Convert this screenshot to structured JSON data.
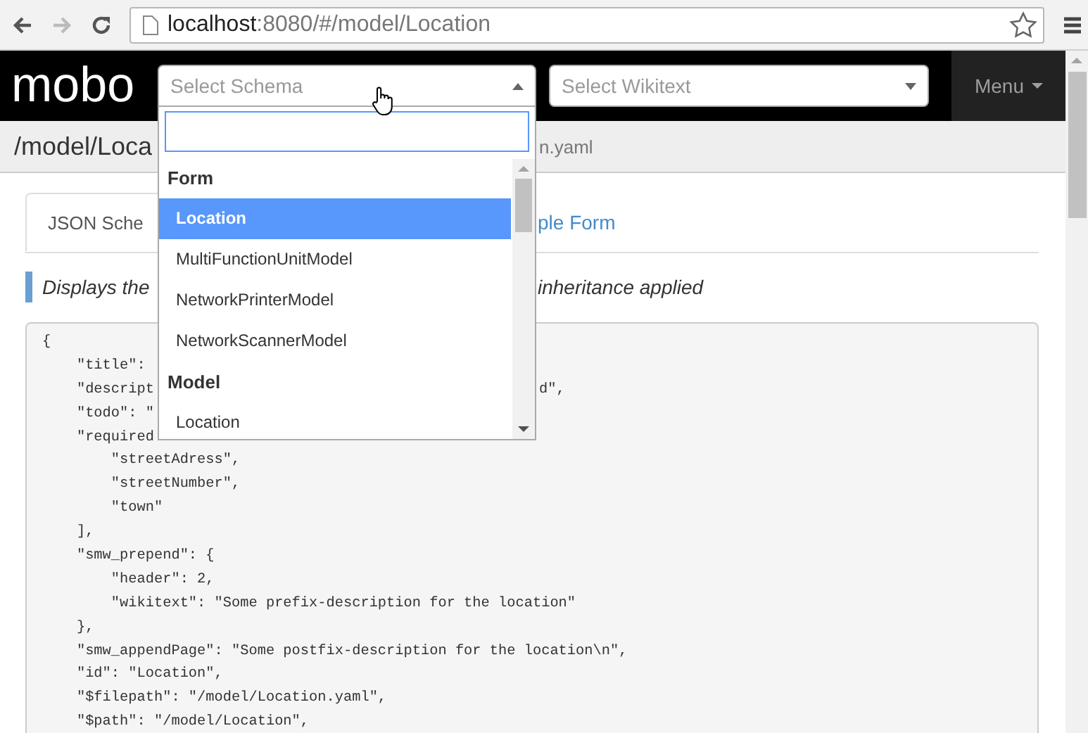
{
  "browser": {
    "address": {
      "host": "localhost",
      "rest": ":8080/#/model/Location"
    }
  },
  "navbar": {
    "brand": "mobo",
    "schema_select": {
      "placeholder": "Select Schema",
      "open": true
    },
    "wikitext_select": {
      "placeholder": "Select Wikitext",
      "open": false
    },
    "menu": "Menu"
  },
  "dropdown": {
    "groups": [
      {
        "label": "Form",
        "items": [
          {
            "label": "Location",
            "selected": true
          },
          {
            "label": "MultiFunctionUnitModel",
            "selected": false
          },
          {
            "label": "NetworkPrinterModel",
            "selected": false
          },
          {
            "label": "NetworkScannerModel",
            "selected": false
          }
        ]
      },
      {
        "label": "Model",
        "items": [
          {
            "label": "Location",
            "selected": false
          }
        ]
      }
    ]
  },
  "header": {
    "path": "/model/Loca",
    "file": "n.yaml"
  },
  "tabs": [
    {
      "label": "JSON Sche",
      "selected": true
    },
    {
      "label": "ple Form",
      "selected": false
    }
  ],
  "description": {
    "left": "Displays the",
    "right": "inheritance applied"
  },
  "code_lines": [
    {
      "text": "{"
    },
    {
      "text": "    \"title\":"
    },
    {
      "text": "    \"descript",
      "right": "d\","
    },
    {
      "text": "    \"todo\": \""
    },
    {
      "text": "    \"required"
    },
    {
      "text": "        \"streetAdress\","
    },
    {
      "text": "        \"streetNumber\","
    },
    {
      "text": "        \"town\""
    },
    {
      "text": "    ],"
    },
    {
      "text": "    \"smw_prepend\": {"
    },
    {
      "text": "        \"header\": 2,"
    },
    {
      "text": "        \"wikitext\": \"Some prefix-description for the location\""
    },
    {
      "text": "    },"
    },
    {
      "text": "    \"smw_appendPage\": \"Some postfix-description for the location\\n\","
    },
    {
      "text": "    \"id\": \"Location\","
    },
    {
      "text": "    \"$filepath\": \"/model/Location.yaml\","
    },
    {
      "text": "    \"$path\": \"/model/Location\","
    }
  ]
}
